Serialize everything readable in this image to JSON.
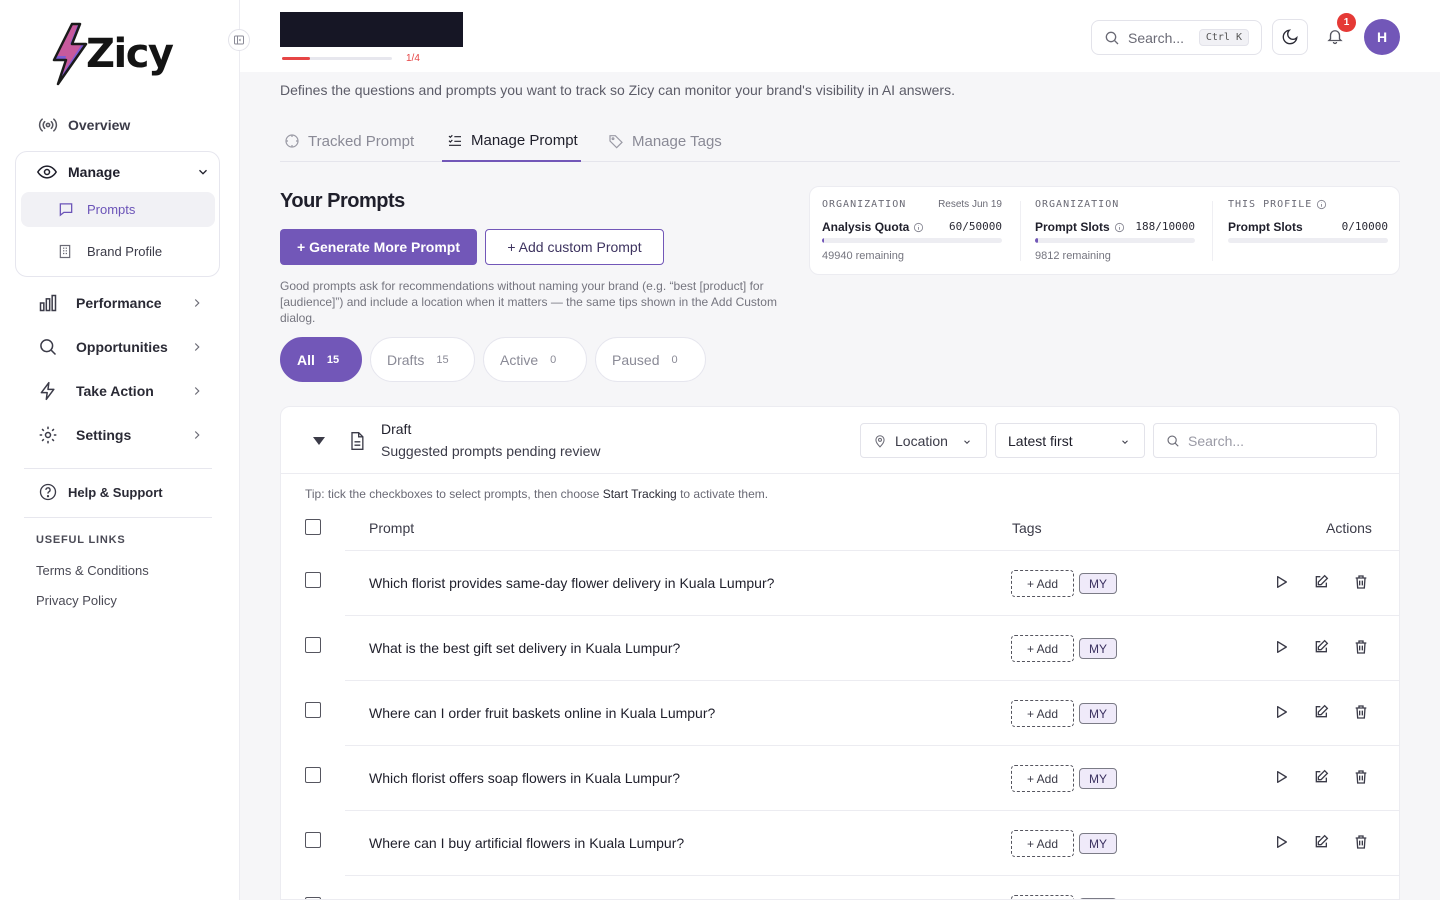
{
  "app": {
    "name": "Zicy"
  },
  "sidebar": {
    "overview": "Overview",
    "manage": "Manage",
    "prompts": "Prompts",
    "brand_profile": "Brand Profile",
    "performance": "Performance",
    "opportunities": "Opportunities",
    "take_action": "Take Action",
    "settings": "Settings",
    "help": "Help & Support",
    "useful_links_title": "USEFUL LINKS",
    "terms": "Terms & Conditions",
    "privacy": "Privacy Policy"
  },
  "topbar": {
    "progress_label": "1/4",
    "progress_fraction": 0.25,
    "search_placeholder": "Search...",
    "search_shortcut": "Ctrl K",
    "notification_count": "1",
    "avatar_initial": "H"
  },
  "page": {
    "description": "Defines the questions and prompts you want to track so Zicy can monitor your brand's visibility in AI answers.",
    "tabs": [
      "Tracked Prompt",
      "Manage Prompt",
      "Manage Tags"
    ],
    "active_tab": "Manage Prompt",
    "section_title": "Your Prompts",
    "generate_button": "+ Generate More Prompt",
    "add_custom_button": "+ Add custom Prompt",
    "tips": "Good prompts ask for recommendations without naming your brand (e.g. “best [product] for [audience]”) and include a location when it matters — the same tips shown in the Add Custom dialog."
  },
  "quota": {
    "analysis": {
      "org": "ORGANIZATION",
      "reset": "Resets Jun 19",
      "label": "Analysis Quota",
      "value": "60/50000",
      "fraction": 0.0012,
      "remaining": "49940 remaining"
    },
    "slots": {
      "org": "ORGANIZATION",
      "label": "Prompt Slots",
      "value": "188/10000",
      "fraction": 0.0188,
      "remaining": "9812 remaining"
    },
    "profile": {
      "org": "THIS PROFILE",
      "label": "Prompt Slots",
      "value": "0/10000",
      "fraction": 0
    }
  },
  "filters": [
    {
      "label": "All",
      "count": "15"
    },
    {
      "label": "Drafts",
      "count": "15"
    },
    {
      "label": "Active",
      "count": "0"
    },
    {
      "label": "Paused",
      "count": "0"
    }
  ],
  "draft": {
    "title": "Draft",
    "subtitle": "Suggested prompts pending review",
    "location_label": "Location",
    "sort_label": "Latest first",
    "search_placeholder": "Search...",
    "tip_prefix": "Tip: tick the checkboxes to select prompts, then choose ",
    "tip_action": "Start Tracking",
    "tip_suffix": " to activate them.",
    "columns": {
      "prompt": "Prompt",
      "tags": "Tags",
      "actions": "Actions"
    },
    "add_tag_label": "+ Add",
    "rows": [
      {
        "prompt": "Which florist provides same-day flower delivery in Kuala Lumpur?",
        "tag": "MY"
      },
      {
        "prompt": "What is the best gift set delivery in Kuala Lumpur?",
        "tag": "MY"
      },
      {
        "prompt": "Where can I order fruit baskets online in Kuala Lumpur?",
        "tag": "MY"
      },
      {
        "prompt": "Which florist offers soap flowers in Kuala Lumpur?",
        "tag": "MY"
      },
      {
        "prompt": "Where can I buy artificial flowers in Kuala Lumpur?",
        "tag": "MY"
      }
    ]
  }
}
